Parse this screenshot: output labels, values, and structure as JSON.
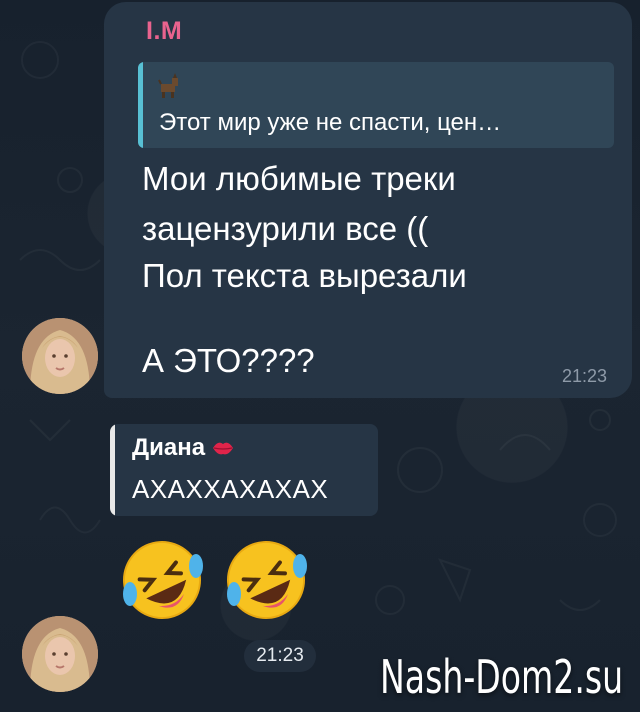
{
  "message1": {
    "sender_name": "I.M",
    "reply_preview": {
      "thumbnail": "dog-sticker-thumbnail",
      "text": "Этот мир уже не спасти, цен…"
    },
    "lines": [
      "Мои любимые треки",
      "зацензурили все ((",
      "Пол текста вырезали",
      "А ЭТО????"
    ],
    "time": "21:23"
  },
  "message2": {
    "quote_author": "Диана",
    "quote_author_emoji": "kiss-lips-icon",
    "quote_text": "АХАХХАХАХАХ",
    "emojis": [
      "rolling-on-floor-laughing-icon",
      "rolling-on-floor-laughing-icon"
    ],
    "time": "21:23"
  },
  "watermark": "Nash-Dom2.su",
  "colors": {
    "background": "#16202c",
    "bubble": "#263545",
    "sender_name": "#e9638e",
    "reply_accent": "#58c0d4",
    "time": "#8e9aa8"
  }
}
